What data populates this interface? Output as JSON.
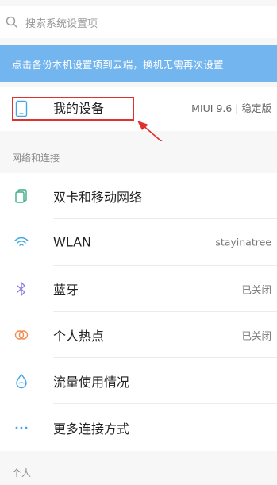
{
  "search": {
    "placeholder": "搜索系统设置项"
  },
  "banner": {
    "text": "点击备份本机设置项到云端，换机无需再次设置"
  },
  "device": {
    "label": "我的设备",
    "value": "MIUI 9.6 | 稳定版"
  },
  "sections": {
    "network": "网络和连接",
    "personal": "个人"
  },
  "network_items": [
    {
      "label": "双卡和移动网络",
      "value": "",
      "icon": "sim-card-icon"
    },
    {
      "label": "WLAN",
      "value": "stayinatree",
      "icon": "wifi-icon"
    },
    {
      "label": "蓝牙",
      "value": "已关闭",
      "icon": "bluetooth-icon"
    },
    {
      "label": "个人热点",
      "value": "已关闭",
      "icon": "hotspot-icon"
    },
    {
      "label": "流量使用情况",
      "value": "",
      "icon": "data-usage-icon"
    },
    {
      "label": "更多连接方式",
      "value": "",
      "icon": "more-icon"
    }
  ],
  "colors": {
    "banner": "#73b5ee",
    "highlight": "#e0312f",
    "sim_icon": "#3fae86",
    "wifi_icon": "#3fa8e6",
    "bluetooth_icon": "#8f7be8",
    "hotspot_icon": "#f08a4b",
    "data_icon": "#3fa8e6",
    "more_icon": "#3fa8e6"
  }
}
